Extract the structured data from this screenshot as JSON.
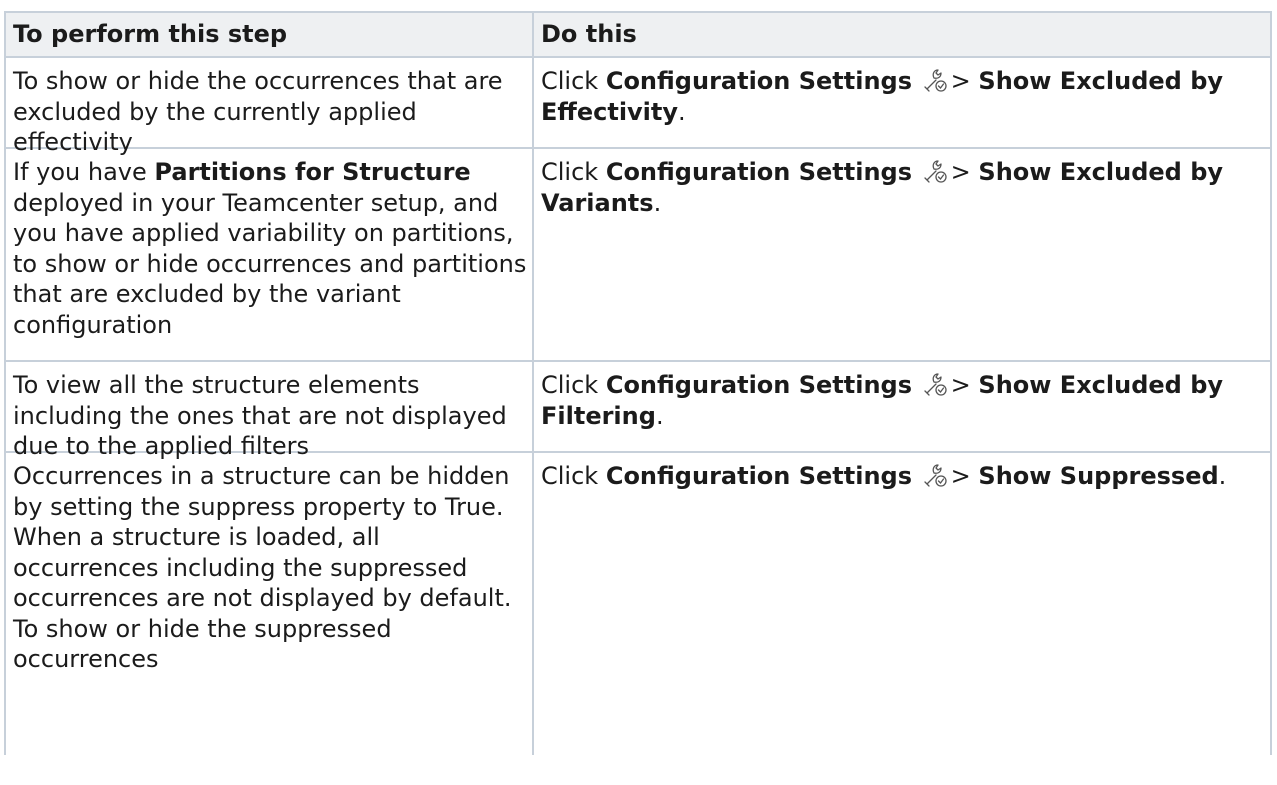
{
  "header": {
    "col1": "To perform this step",
    "col2": "Do this"
  },
  "rows": [
    {
      "step": "To show or hide the occurrences that are excluded by the currently applied effectivity",
      "click": "Click",
      "menu": "Configuration Settings",
      "icon": "configuration-settings-icon",
      "sep": ">",
      "option": "Show Excluded by Effectivity",
      "end": "."
    },
    {
      "step_pre": "If you have",
      "step_bold": "Partitions for Structure",
      "step_post": "deployed in your Teamcenter setup, and you have applied variability on partitions, to show or hide occurrences and partitions that are excluded by the variant configuration",
      "click": "Click",
      "menu": "Configuration Settings",
      "icon": "configuration-settings-icon",
      "sep": ">",
      "option": "Show Excluded by Variants",
      "end": "."
    },
    {
      "step": "To view all the structure elements including the ones that are not displayed due to the applied filters",
      "click": "Click",
      "menu": "Configuration Settings",
      "icon": "configuration-settings-icon",
      "sep": ">",
      "option": "Show Excluded by Filtering",
      "end": "."
    },
    {
      "step": "Occurrences in a structure can be hidden by setting the suppress property to True. When a structure is loaded, all occurrences including the suppressed occurrences are not displayed by default. To show or hide the suppressed occurrences",
      "click": "Click",
      "menu": "Configuration Settings",
      "icon": "configuration-settings-icon",
      "sep": ">",
      "option": "Show Suppressed",
      "end": "."
    }
  ]
}
